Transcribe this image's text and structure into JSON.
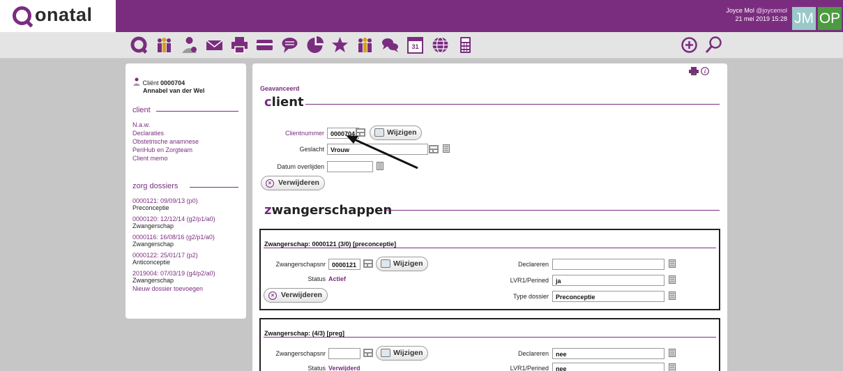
{
  "brand": {
    "name": "onatal",
    "primary_color": "#7a2d7f"
  },
  "user": {
    "name": "Joyce Mol",
    "handle": "@joycemol",
    "datetime": "21 mei 2019 15:28",
    "badge1": "JM",
    "badge2": "OP"
  },
  "toolbar": {
    "icons": [
      "home-q-icon",
      "people-icon",
      "person-icon",
      "mail-icon",
      "print-icon",
      "card-icon",
      "chat-bubble-icon",
      "pie-chart-icon",
      "star-icon",
      "group-icon",
      "conversation-icon",
      "calendar-icon",
      "globe-icon",
      "calculator-icon"
    ],
    "calendar_day": "31",
    "right_icons": [
      "add-icon",
      "search-icon"
    ]
  },
  "sidebar": {
    "client_prefix": "Cliënt",
    "client_number": "0000704",
    "client_name": "Annabel van der Wel",
    "client_section": "client",
    "client_links": [
      "N.a.w.",
      "Declaraties",
      "Obstetrische anamnese",
      "PeriHub en Zorgteam",
      "Client memo"
    ],
    "dossiers_section": "zorg dossiers",
    "dossiers": [
      {
        "id": "0000121: 09/09/13 (p0)",
        "type": "Preconceptie"
      },
      {
        "id": "0000120: 12/12/14 (g2/p1/a0)",
        "type": "Zwangerschap"
      },
      {
        "id": "0000116: 16/08/16 (g2/p1/a0)",
        "type": "Zwangerschap"
      },
      {
        "id": "0000122: 25/01/17 (p2)",
        "type": "Anticonceptie"
      },
      {
        "id": "2019004: 07/03/19 (g4/p2/a0)",
        "type": "Zwangerschap"
      }
    ],
    "new_dossier": "Nieuw dossier toevoegen"
  },
  "main": {
    "advanced": "Geavanceerd",
    "client_heading_first": "c",
    "client_heading_rest": "lient",
    "clientnummer_label": "Clientnummer",
    "clientnummer_value": "0000704",
    "change_button": "Wijzigen",
    "geslacht_label": "Geslacht",
    "geslacht_value": "Vrouw",
    "overlijden_label": "Datum overlijden",
    "overlijden_value": "",
    "delete_button": "Verwijderen",
    "preg_heading_first": "z",
    "preg_heading_rest": "wangerschappen"
  },
  "pregnancies": [
    {
      "title": "Zwangerschap: 0000121 (3/0) [preconceptie]",
      "nr_label": "Zwangerschapsnr",
      "nr_value": "0000121",
      "change_button": "Wijzigen",
      "status_label": "Status",
      "status_value": "Actief",
      "delete_button": "Verwijderen",
      "declareren_label": "Declareren",
      "declareren_value": "",
      "lvr_label": "LVR1/Perined",
      "lvr_value": "ja",
      "type_label": "Type dossier",
      "type_value": "Preconceptie"
    },
    {
      "title": "Zwangerschap: (4/3) [preg]",
      "nr_label": "Zwangerschapsnr",
      "nr_value": "",
      "change_button": "Wijzigen",
      "status_label": "Status",
      "status_value": "Verwijderd",
      "declareren_label": "Declareren",
      "declareren_value": "nee",
      "lvr_label": "LVR1/Perined",
      "lvr_value": "nee"
    }
  ]
}
